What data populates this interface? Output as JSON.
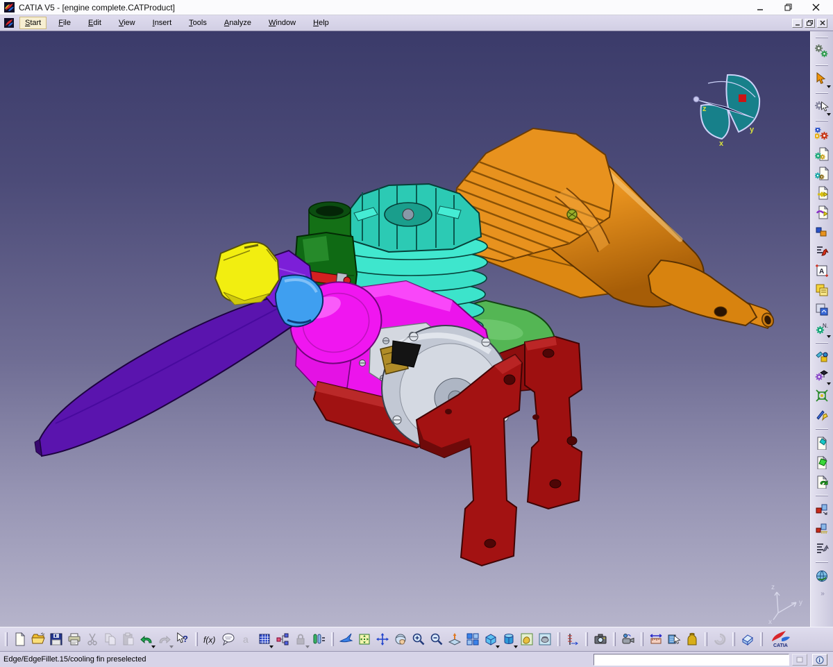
{
  "window": {
    "title": "CATIA V5 - [engine complete.CATProduct]",
    "controls": [
      "minimize",
      "restore",
      "close"
    ]
  },
  "menu": {
    "items": [
      {
        "label": "Start",
        "active": true
      },
      {
        "label": "File"
      },
      {
        "label": "Edit"
      },
      {
        "label": "View"
      },
      {
        "label": "Insert"
      },
      {
        "label": "Tools"
      },
      {
        "label": "Analyze"
      },
      {
        "label": "Window"
      },
      {
        "label": "Help"
      }
    ],
    "mdi_controls": [
      "minimize",
      "restore",
      "close"
    ]
  },
  "viewport": {
    "document": "engine complete.CATProduct",
    "compass": {
      "x": "x",
      "y": "y",
      "z": "z"
    },
    "triad": {
      "x": "x",
      "y": "y",
      "z": "z"
    },
    "parts": [
      {
        "name": "propeller-blade",
        "color": "#5a14ae"
      },
      {
        "name": "spinner-nut",
        "color": "#f2ee10"
      },
      {
        "name": "prop-hub",
        "color": "#7c1fd8"
      },
      {
        "name": "drive-washer",
        "color": "#3f9ff0"
      },
      {
        "name": "crankcase",
        "color": "#ec14ec"
      },
      {
        "name": "cylinder-cooling-fins",
        "color": "#3ae0c8"
      },
      {
        "name": "cylinder-head",
        "color": "#2ccab4"
      },
      {
        "name": "carburetor",
        "color": "#0f6a14"
      },
      {
        "name": "needle-valve",
        "color": "#d42020"
      },
      {
        "name": "muffler",
        "color": "#e8921e"
      },
      {
        "name": "exhaust-manifold",
        "color": "#54b654"
      },
      {
        "name": "backplate",
        "color": "#c2c8d4"
      },
      {
        "name": "engine-mount-bracket-left",
        "color": "#a31212"
      },
      {
        "name": "engine-mount-bracket-right",
        "color": "#9e1010"
      }
    ]
  },
  "toolbars": {
    "right_items": [
      "update",
      "select",
      "selection-filter",
      "assembly-gears",
      "generate-specs",
      "generate-report",
      "export-data",
      "export-data-alt",
      "catalog",
      "product-structure",
      "frame-title-block",
      "bill-of-material",
      "scene-frame",
      "generate-numbering",
      "workbench-tools",
      "learning-assistant",
      "snap",
      "smart-move",
      "import-existing",
      "import-with-positioning",
      "replace-component",
      "manipulate",
      "snap-ruler",
      "graph-tree-reordering",
      "web-publish",
      "more-toolbars"
    ],
    "bottom_items": [
      "new-document",
      "open",
      "save",
      "print",
      "cut",
      "copy",
      "paste",
      "undo",
      "redo",
      "whats-this",
      "formula",
      "comments",
      "annotations",
      "design-table",
      "relations",
      "lock",
      "equivalent-dimensions",
      "fly-mode",
      "fit-all-in",
      "pan",
      "rotate",
      "zoom-in",
      "zoom-out",
      "normal-view",
      "multi-view",
      "isometric-view",
      "render-style",
      "shading-with-material",
      "custom-view",
      "dimensions",
      "capture",
      "video-recorder",
      "measure-between",
      "measure-item",
      "mass-properties",
      "knowledge-inspector",
      "eraser-3d",
      "catia-logo"
    ],
    "formula_glyph": "f(x)",
    "whats_this_glyph": "?",
    "logo_text": "CATIA"
  },
  "status_bar": {
    "message": "Edge/EdgeFillet.15/cooling fin preselected",
    "command_value": ""
  },
  "colors": {
    "viewport_top": "#3b3b6a",
    "viewport_bottom": "#b6b4cb",
    "toolbar_bg": "#d5d2e6",
    "menu_highlight": "#f7efd2",
    "compass_teal": "#17808a",
    "compass_label": "#d8e03c"
  }
}
